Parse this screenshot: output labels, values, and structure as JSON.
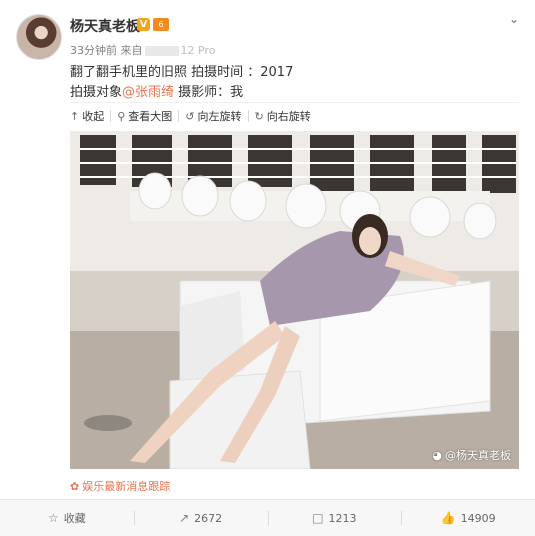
{
  "author": {
    "name": "杨天真老板",
    "verified_badge": "V",
    "level_badge": "6"
  },
  "meta": {
    "time": "33分钟前",
    "source_prefix": "来自",
    "source_tail": "12 Pro"
  },
  "post": {
    "line1": "翻了翻手机里的旧照 拍摄时间 ：2017",
    "line2_prefix": "拍摄对象",
    "mention": "@张雨绮",
    "line2_suffix": " 摄影师：我"
  },
  "toolbar": {
    "collapse": "收起",
    "view_large": "查看大图",
    "rotate_left": "向左旋转",
    "rotate_right": "向右旋转"
  },
  "image": {
    "watermark": "@杨天真老板"
  },
  "source_tag": "娱乐最新消息跟踪",
  "actions": {
    "favorite": "收藏",
    "repost": "2672",
    "comment": "1213",
    "like": "14909"
  },
  "colors": {
    "accent": "#eb7350",
    "badge": "#f7a21b"
  }
}
